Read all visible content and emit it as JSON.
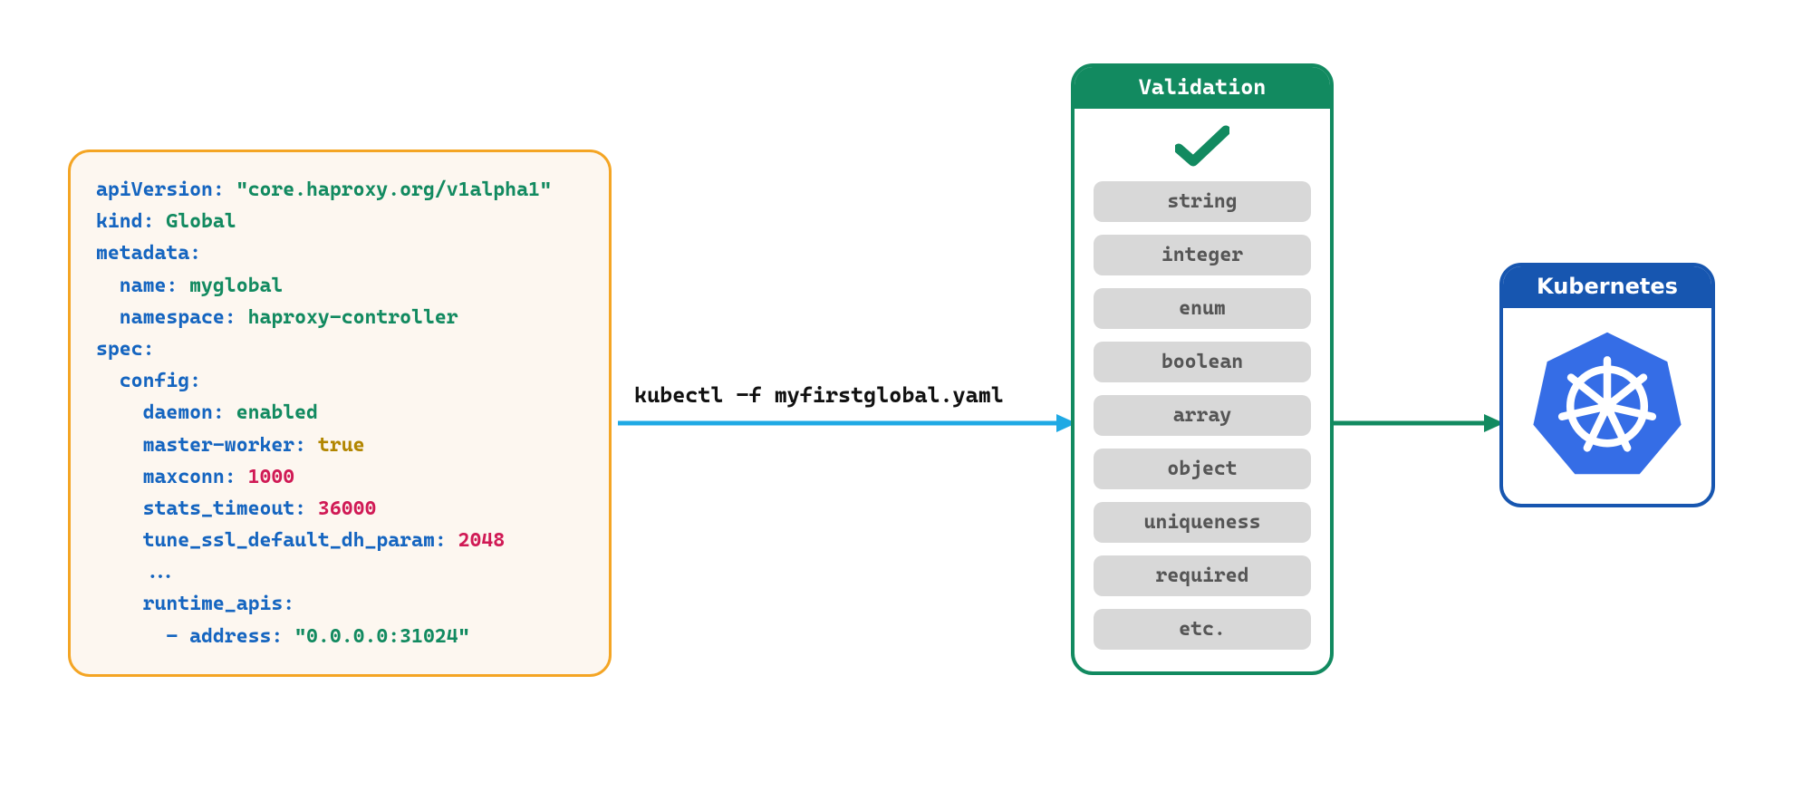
{
  "yaml": {
    "l1_key": "apiVersion:",
    "l1_val": "\"core.haproxy.org/v1alpha1\"",
    "l2_key": "kind:",
    "l2_val": "Global",
    "l3_key": "metadata:",
    "l4_key": "name:",
    "l4_val": "myglobal",
    "l5_key": "namespace:",
    "l5_val": "haproxy-controller",
    "l6_key": "spec:",
    "l7_key": "config:",
    "l8_key": "daemon:",
    "l8_val": "enabled",
    "l9_key": "master-worker:",
    "l9_val": "true",
    "l10_key": "maxconn:",
    "l10_val": "1000",
    "l11_key": "stats_timeout:",
    "l11_val": "36000",
    "l12_key": "tune_ssl_default_dh_param:",
    "l12_val": "2048",
    "l13_dots": "...",
    "l14_key": "runtime_apis:",
    "l15_dash": "- ",
    "l15_key": "address:",
    "l15_val": "\"0.0.0.0:31024\""
  },
  "command": "kubectl -f myfirstglobal.yaml",
  "validation": {
    "title": "Validation",
    "items": [
      "string",
      "integer",
      "enum",
      "boolean",
      "array",
      "object",
      "uniqueness",
      "required",
      "etc."
    ]
  },
  "k8s": {
    "title": "Kubernetes"
  },
  "colors": {
    "orange": "#f4a524",
    "green": "#128a60",
    "blue": "#1756b0",
    "k8sBlue": "#356de6",
    "arrowCyan": "#1fa9e4"
  }
}
